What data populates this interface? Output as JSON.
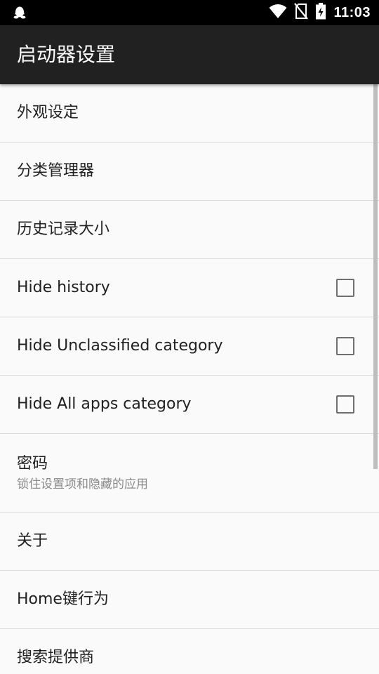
{
  "status_bar": {
    "time": "11:03",
    "icons": [
      "qq-penguin-icon",
      "wifi-icon",
      "no-sim-icon",
      "battery-charging-icon"
    ]
  },
  "toolbar": {
    "title": "启动器设置"
  },
  "settings": {
    "items": [
      {
        "title": "外观设定"
      },
      {
        "title": "分类管理器"
      },
      {
        "title": "历史记录大小"
      },
      {
        "title": "Hide history",
        "checked": false
      },
      {
        "title": "Hide Unclassified category",
        "checked": false
      },
      {
        "title": "Hide All apps category",
        "checked": false
      },
      {
        "title": "密码",
        "summary": "锁住设置项和隐藏的应用"
      },
      {
        "title": "关于"
      },
      {
        "title": "Home键行为"
      },
      {
        "title": "搜索提供商"
      }
    ]
  }
}
